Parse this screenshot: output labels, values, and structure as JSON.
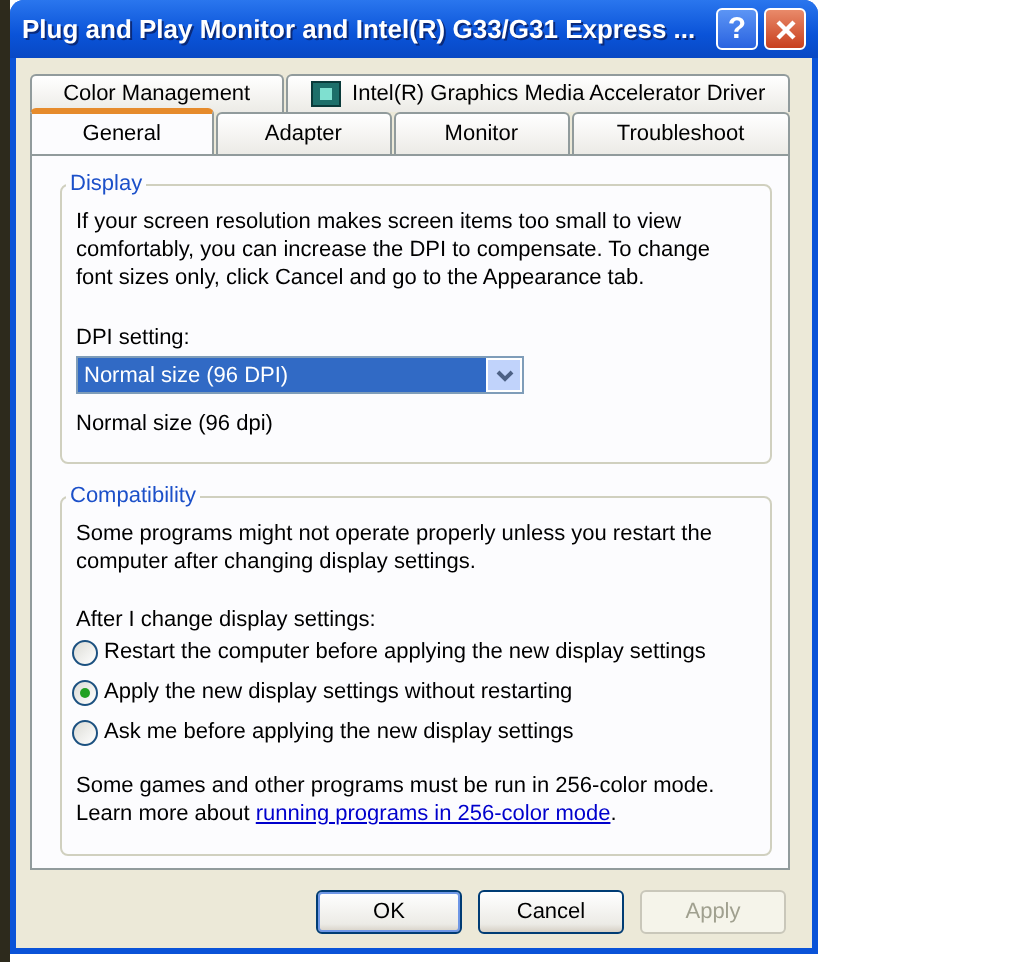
{
  "window": {
    "title": "Plug and Play Monitor and Intel(R) G33/G31 Express ...",
    "help_button": "?"
  },
  "tab_rows": [
    [
      {
        "label": "Color Management",
        "selected": false,
        "has_icon": false
      },
      {
        "label": "Intel(R) Graphics Media Accelerator Driver",
        "selected": false,
        "has_icon": true
      }
    ],
    [
      {
        "label": "General",
        "selected": true,
        "has_icon": false
      },
      {
        "label": "Adapter",
        "selected": false,
        "has_icon": false
      },
      {
        "label": "Monitor",
        "selected": false,
        "has_icon": false
      },
      {
        "label": "Troubleshoot",
        "selected": false,
        "has_icon": false
      }
    ]
  ],
  "display": {
    "legend": "Display",
    "description": "If your screen resolution makes screen items too small to view comfortably, you can increase the DPI to compensate.  To change font sizes only, click Cancel and go to the Appearance tab.",
    "dpi_label": "DPI setting:",
    "dpi_value": "Normal size (96 DPI)",
    "dpi_note": "Normal size (96 dpi)"
  },
  "compatibility": {
    "legend": "Compatibility",
    "description": "Some programs might not operate properly unless you restart the computer after changing display settings.",
    "prompt": "After I change display settings:",
    "options": [
      {
        "label": "Restart the computer before applying the new display settings",
        "selected": false
      },
      {
        "label": "Apply the new display settings without restarting",
        "selected": true
      },
      {
        "label": "Ask me before applying the new display settings",
        "selected": false
      }
    ],
    "note": "Some games and other programs must be run in 256-color mode.",
    "learn_prefix": "Learn more about",
    "link": "running programs in 256-color mode",
    "learn_suffix": "."
  },
  "buttons": [
    {
      "label": "OK",
      "default": true,
      "disabled": false
    },
    {
      "label": "Cancel",
      "default": false,
      "disabled": false
    },
    {
      "label": "Apply",
      "default": false,
      "disabled": true
    }
  ]
}
